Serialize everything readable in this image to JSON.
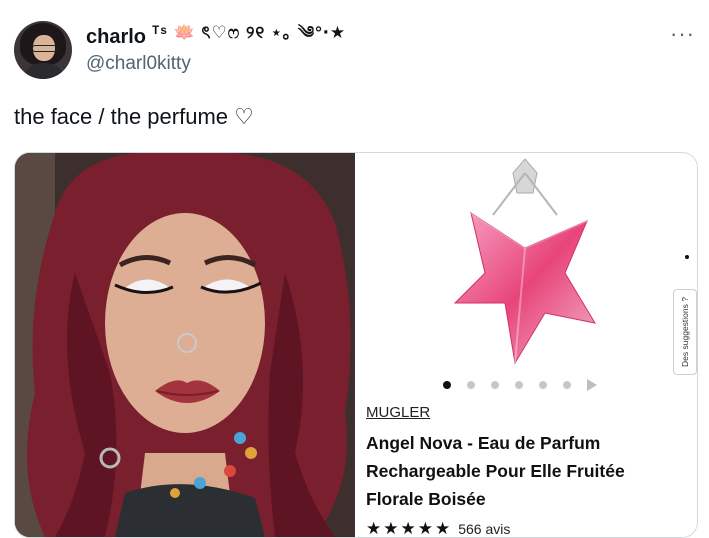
{
  "author": {
    "display_name": "charlo",
    "name_decoration": "ᵀˢ 🪷 ৎ♡ෆ ୨୧ ⋆｡ ༄°‧★",
    "handle": "@charl0kitty"
  },
  "tweet": {
    "text": "the face / the perfume ♡",
    "more_label": "···"
  },
  "product": {
    "brand": "MUGLER",
    "name": "Angel Nova - Eau de Parfum Rechargeable Pour Elle Fruitée Florale Boisée",
    "rating_stars": "★★★★★",
    "reviews": "566 avis",
    "suggestions_label": "Des suggestions ?",
    "carousel_total": 6,
    "carousel_active": 1
  },
  "colors": {
    "text": "#0f1419",
    "secondary": "#536471",
    "border": "#cfd9de",
    "hair": "#7a1f2e",
    "perfume_pink": "#e8457a"
  }
}
